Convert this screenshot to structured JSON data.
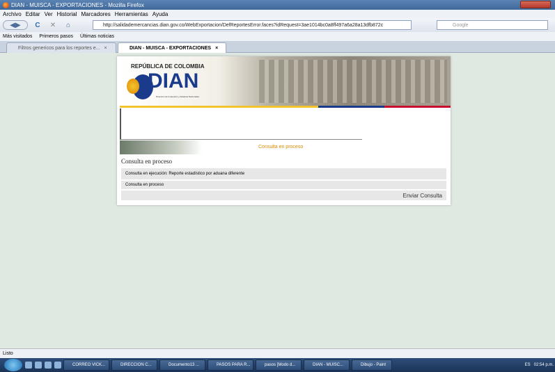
{
  "window": {
    "title": "DIAN - MUISCA - EXPORTACIONES - Mozilla Firefox"
  },
  "menu": [
    "Archivo",
    "Editar",
    "Ver",
    "Historial",
    "Marcadores",
    "Herramientas",
    "Ayuda"
  ],
  "nav": {
    "url": "http://salidademercancias.dian.gov.co/WebExportacion/DefReportesError.faces?idRequest=3ae1014bc0a8ff497a6a28a13dfb872c",
    "search_placeholder": "Google"
  },
  "bookmarks": [
    "Más visitados",
    "Primeros pasos",
    "Últimas noticias"
  ],
  "tabs": [
    {
      "label": "Filtros genericos para los reportes e..."
    },
    {
      "label": "DIAN - MUISCA - EXPORTACIONES"
    }
  ],
  "page": {
    "header_country": "REPÚBLICA DE COLOMBIA",
    "header_logo": "DIAN",
    "header_sub": "Dirección de Impuestos y Aduanas Nacionales",
    "status_label": "Consulta en proceso",
    "heading": "Consulta en proceso",
    "row1": "Consulta en ejecución: Reporte estadístico por aduana diferente",
    "row2": "Consulta en proceso",
    "send_button": "Enviar Consulta"
  },
  "status": "Listo",
  "taskbar": {
    "items": [
      "CORREO VICK...",
      "DIRECCION C...",
      "Documento13 ...",
      "PASOS PARA R...",
      "pasos [Modo d...",
      "DIAN - MUISC...",
      "Dibujo - Paint"
    ],
    "lang": "ES",
    "time": "02:54 p.m."
  }
}
